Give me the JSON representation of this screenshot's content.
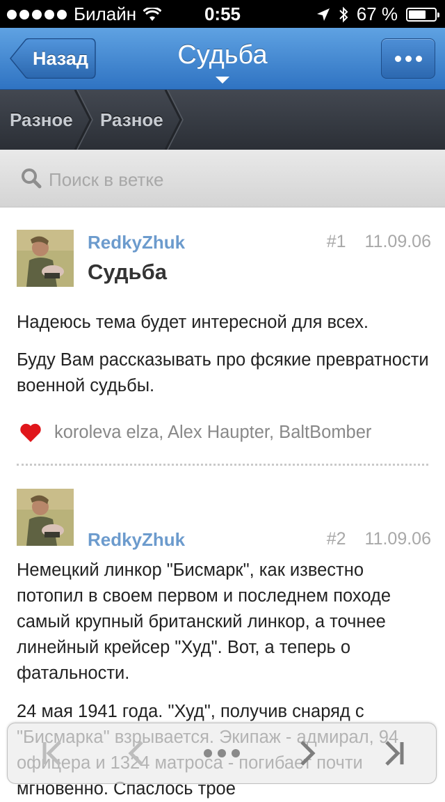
{
  "status_bar": {
    "carrier": "Билайн",
    "time": "0:55",
    "battery": "67 %",
    "battery_level": 0.67
  },
  "nav": {
    "back_label": "Назад",
    "title": "Судьба"
  },
  "breadcrumbs": [
    "Разное",
    "Разное"
  ],
  "search": {
    "placeholder": "Поиск в ветке"
  },
  "posts": [
    {
      "author": "RedkyZhuk",
      "number": "#1",
      "date": "11.09.06",
      "title": "Судьба",
      "paragraphs": [
        "Надеюсь тема будет интересной для всех.",
        "Буду Вам рассказывать про фсякие превратности военной судьбы."
      ],
      "likes": "koroleva elza, Alex Haupter, BaltBomber"
    },
    {
      "author": "RedkyZhuk",
      "number": "#2",
      "date": "11.09.06",
      "paragraphs": [
        "Немецкий линкор \"Бисмарк\", как известно потопил в своем первом и последнем походе самый крупный британский линкор, а точнее линейный крейсер \"Худ\". Вот, а теперь о фатальности.",
        "24 мая 1941 года. \"Худ\", получив снаряд с \"Бисмарка\" взрывается. Экипаж - адмирал, 94 офицера и 1324 матроса - погибает почти мгновенно. Спаслось трое"
      ]
    }
  ],
  "toolbar": {
    "icons": [
      "first-page-icon",
      "previous-page-icon",
      "more-icon",
      "next-page-icon",
      "last-page-icon"
    ]
  },
  "colors": {
    "nav_blue": "#3a80cf",
    "author_link": "#6c9bcd",
    "heart": "#e0161b"
  }
}
